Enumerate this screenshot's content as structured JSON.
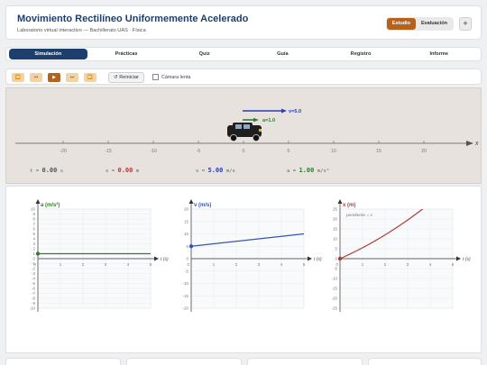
{
  "header": {
    "title": "Movimiento Rectilíneo Uniformemente Acelerado",
    "subtitle": "Laboratorio virtual interactivo — Bachillerato UAS · Física",
    "mode_study": "Estudio",
    "mode_eval": "Evaluación",
    "plus": "+"
  },
  "nav": {
    "tabs": [
      "Simulación",
      "Prácticas",
      "Quiz",
      "Guía",
      "Registro",
      "Informe"
    ],
    "active": 0
  },
  "controls": {
    "buttons": [
      {
        "name": "rewind-start-button",
        "glyph": "⏪"
      },
      {
        "name": "step-back-button",
        "glyph": "⏮"
      },
      {
        "name": "play-button",
        "glyph": "▶"
      },
      {
        "name": "step-forward-button",
        "glyph": "⏭"
      },
      {
        "name": "fast-forward-button",
        "glyph": "⏩"
      }
    ],
    "reset_label": "↺ Reiniciar",
    "slow_label": "Cámara lenta"
  },
  "sim": {
    "axis_label": "x",
    "ticks": [
      "-20",
      "-15",
      "-10",
      "-5",
      "0",
      "5",
      "10",
      "15",
      "20"
    ],
    "velocity_label": "v=5.0",
    "accel_label": "a=1.0",
    "readouts": {
      "t": {
        "label": "t =",
        "value": "0.00",
        "unit": "s"
      },
      "x": {
        "label": "x =",
        "value": "0.00",
        "unit": "m"
      },
      "v": {
        "label": "v =",
        "value": "5.00",
        "unit": "m/s"
      },
      "a": {
        "label": "a =",
        "value": "1.00",
        "unit": "m/s²"
      }
    }
  },
  "chart_data": [
    {
      "type": "line",
      "ylabel": "a (m/s²)",
      "xlabel": "t (s)",
      "xlim": [
        0,
        5
      ],
      "ylim": [
        -10,
        10
      ],
      "x": [
        0,
        5
      ],
      "y": [
        1,
        1
      ],
      "color": "#2e7d32"
    },
    {
      "type": "line",
      "ylabel": "v (m/s)",
      "xlabel": "t (s)",
      "xlim": [
        0,
        5
      ],
      "ylim": [
        -20,
        20
      ],
      "x": [
        0,
        5
      ],
      "y": [
        5,
        10
      ],
      "color": "#3355aa"
    },
    {
      "type": "line",
      "ylabel": "x (m)",
      "xlabel": "t (s)",
      "xlim": [
        0,
        5
      ],
      "ylim": [
        -25,
        25
      ],
      "x": [
        0,
        1,
        2,
        3,
        4,
        5
      ],
      "y": [
        0,
        5.5,
        12,
        19.5,
        28,
        37.5
      ],
      "annotation": "pendiente = v",
      "color": "#b03a3a"
    }
  ]
}
